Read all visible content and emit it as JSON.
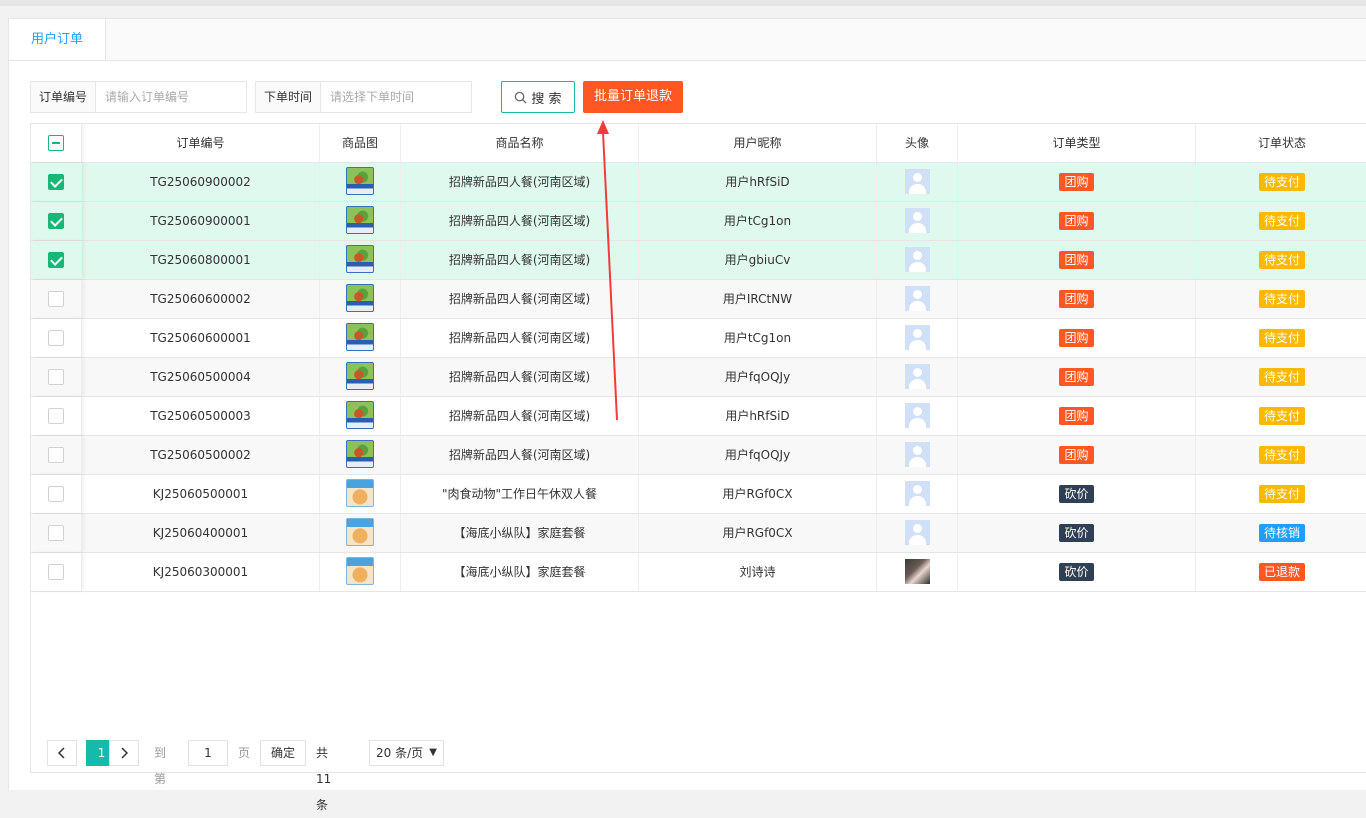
{
  "tab": {
    "label": "用户订单"
  },
  "search": {
    "order_no_label": "订单编号",
    "order_no_placeholder": "请输入订单编号",
    "time_label": "下单时间",
    "time_placeholder": "请选择下单时间",
    "search_button": "搜 索",
    "refund_button": "批量订单退款"
  },
  "colors": {
    "accent": "#16baaa",
    "refund": "#ff5722",
    "tag_group": "#ff5722",
    "tag_bargain": "#2f4056",
    "st_pending": "#ffb800",
    "st_verify": "#1e9fff",
    "st_refunded": "#ff5722",
    "annotation_arrow": "#f23c3c"
  },
  "table": {
    "headers": [
      "订单编号",
      "商品图",
      "商品名称",
      "用户昵称",
      "头像",
      "订单类型",
      "订单状态"
    ],
    "rows": [
      {
        "checked": true,
        "order_no": "TG25060900002",
        "img": "green",
        "name": "招牌新品四人餐(河南区域)",
        "nickname": "用户hRfSiD",
        "avatar": "default",
        "type": "团购",
        "type_color": "#ff5722",
        "status": "待支付",
        "status_color": "#ffb800"
      },
      {
        "checked": true,
        "order_no": "TG25060900001",
        "img": "green",
        "name": "招牌新品四人餐(河南区域)",
        "nickname": "用户tCg1on",
        "avatar": "default",
        "type": "团购",
        "type_color": "#ff5722",
        "status": "待支付",
        "status_color": "#ffb800"
      },
      {
        "checked": true,
        "order_no": "TG25060800001",
        "img": "green",
        "name": "招牌新品四人餐(河南区域)",
        "nickname": "用户gbiuCv",
        "avatar": "default",
        "type": "团购",
        "type_color": "#ff5722",
        "status": "待支付",
        "status_color": "#ffb800"
      },
      {
        "checked": false,
        "order_no": "TG25060600002",
        "img": "green",
        "name": "招牌新品四人餐(河南区域)",
        "nickname": "用户IRCtNW",
        "avatar": "default",
        "type": "团购",
        "type_color": "#ff5722",
        "status": "待支付",
        "status_color": "#ffb800"
      },
      {
        "checked": false,
        "order_no": "TG25060600001",
        "img": "green",
        "name": "招牌新品四人餐(河南区域)",
        "nickname": "用户tCg1on",
        "avatar": "default",
        "type": "团购",
        "type_color": "#ff5722",
        "status": "待支付",
        "status_color": "#ffb800"
      },
      {
        "checked": false,
        "order_no": "TG25060500004",
        "img": "green",
        "name": "招牌新品四人餐(河南区域)",
        "nickname": "用户fqOQJy",
        "avatar": "default",
        "type": "团购",
        "type_color": "#ff5722",
        "status": "待支付",
        "status_color": "#ffb800"
      },
      {
        "checked": false,
        "order_no": "TG25060500003",
        "img": "green",
        "name": "招牌新品四人餐(河南区域)",
        "nickname": "用户hRfSiD",
        "avatar": "default",
        "type": "团购",
        "type_color": "#ff5722",
        "status": "待支付",
        "status_color": "#ffb800"
      },
      {
        "checked": false,
        "order_no": "TG25060500002",
        "img": "green",
        "name": "招牌新品四人餐(河南区域)",
        "nickname": "用户fqOQJy",
        "avatar": "default",
        "type": "团购",
        "type_color": "#ff5722",
        "status": "待支付",
        "status_color": "#ffb800"
      },
      {
        "checked": false,
        "order_no": "KJ25060500001",
        "img": "blue",
        "name": "\"肉食动物\"工作日午休双人餐",
        "nickname": "用户RGf0CX",
        "avatar": "default",
        "type": "砍价",
        "type_color": "#2f4056",
        "status": "待支付",
        "status_color": "#ffb800"
      },
      {
        "checked": false,
        "order_no": "KJ25060400001",
        "img": "blue",
        "name": "【海底小纵队】家庭套餐",
        "nickname": "用户RGf0CX",
        "avatar": "default",
        "type": "砍价",
        "type_color": "#2f4056",
        "status": "待核销",
        "status_color": "#1e9fff"
      },
      {
        "checked": false,
        "order_no": "KJ25060300001",
        "img": "blue",
        "name": "【海底小纵队】家庭套餐",
        "nickname": "刘诗诗",
        "avatar": "photo",
        "type": "砍价",
        "type_color": "#2f4056",
        "status": "已退款",
        "status_color": "#ff5722"
      }
    ]
  },
  "pagination": {
    "current": "1",
    "goto_label": "到第",
    "page_input": "1",
    "page_unit": "页",
    "confirm": "确定",
    "total": "共 11 条",
    "page_size": "20 条/页"
  }
}
